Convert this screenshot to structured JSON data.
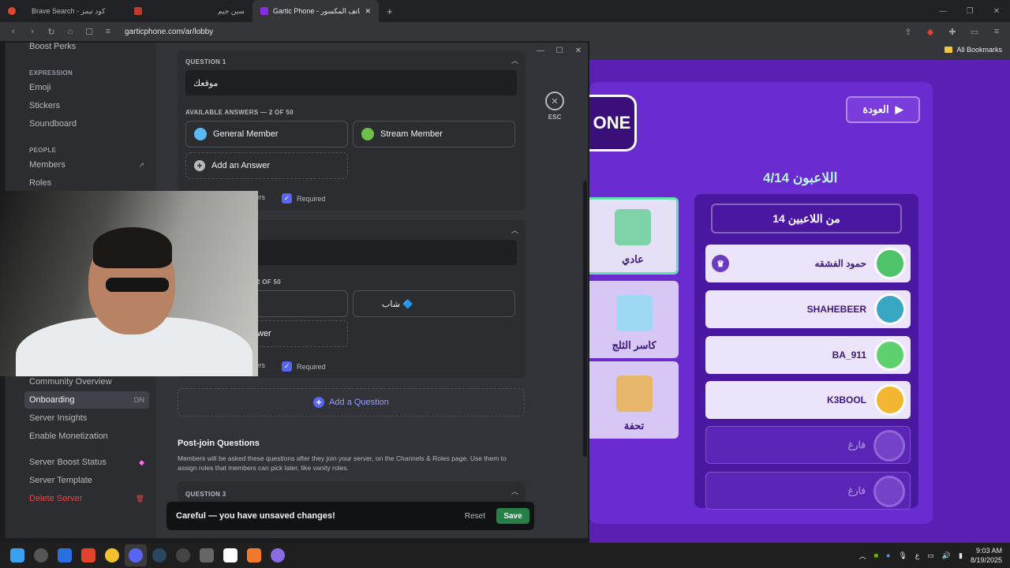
{
  "browser": {
    "tabs": [
      {
        "label": "Brave Search - كود تيمز",
        "color": "#e0442a",
        "active": false
      },
      {
        "label": "سين جيم",
        "color": "#c0392b",
        "active": false
      },
      {
        "label": "Gartic Phone - لعبة الهاتف المكسور",
        "color": "#8a2be2",
        "active": true
      }
    ],
    "new_tab": "+",
    "url": "garticphone.com/ar/lobby",
    "bookmarks_label": "All Bookmarks"
  },
  "game": {
    "back_label": "العودة",
    "logo_text": "ONE",
    "players_title": "اللاعبون 4/14",
    "players_header": "14 من اللاعبين",
    "players": [
      {
        "name": "حمود الفشقه",
        "empty": false,
        "crown": true,
        "color": "#4ec36a"
      },
      {
        "name": "SHAHEBEER",
        "empty": false,
        "crown": false,
        "color": "#3aa7c2"
      },
      {
        "name": "BA_911",
        "empty": false,
        "crown": false,
        "color": "#5ed06e"
      },
      {
        "name": "K3BOOL",
        "empty": false,
        "crown": false,
        "color": "#f2b632"
      },
      {
        "name": "فارغ",
        "empty": true,
        "crown": false,
        "color": "#7442c8"
      },
      {
        "name": "فارغ",
        "empty": true,
        "crown": false,
        "color": "#7442c8"
      }
    ],
    "modes": [
      {
        "label": "عادي",
        "selected": true,
        "color": "#7fd3a8"
      },
      {
        "label": "كاسر الثلج",
        "selected": false,
        "color": "#9fd8f5"
      },
      {
        "label": "تحفة",
        "selected": false,
        "color": "#e6b66a"
      }
    ]
  },
  "discord": {
    "sidebar": {
      "top_item": "Boost Perks",
      "expression_header": "EXPRESSION",
      "expression_items": [
        "Emoji",
        "Stickers",
        "Soundboard"
      ],
      "people_header": "PEOPLE",
      "people_items": [
        "Members",
        "Roles"
      ],
      "community_items": [
        {
          "label": "Community Overview",
          "right": ""
        },
        {
          "label": "Onboarding",
          "right": "ON"
        },
        {
          "label": "Server Insights",
          "right": ""
        },
        {
          "label": "Enable Monetization",
          "right": ""
        }
      ],
      "boost_status": "Server Boost Status",
      "server_template": "Server Template",
      "delete_server": "Delete Server"
    },
    "question1": {
      "label": "QUESTION 1",
      "value": "موقعك",
      "answers_label": "AVAILABLE ANSWERS — 2 OF 50",
      "answers": [
        {
          "label": "General Member",
          "color": "#5ab8f5"
        },
        {
          "label": "Stream Member",
          "color": "#6cc04a"
        }
      ],
      "add_answer": "Add an Answer",
      "multi_label": "Allow Multiple Answers",
      "multi_visible": "wers",
      "required": "Required"
    },
    "question2": {
      "answers_label_visible": "2 OF 50",
      "answer_right": "شاب 🔷",
      "add_answer_visible": "wer",
      "multi_visible": "wers",
      "required": "Required"
    },
    "add_question": "Add a Question",
    "post_join_title": "Post-join Questions",
    "post_join_desc": "Members will be asked these questions after they join your server, on the Channels & Roles page. Use them to assign roles that members can pick later, like vanity roles.",
    "question3_label": "QUESTION 3",
    "esc_label": "ESC",
    "unsaved_text": "Careful — you have unsaved changes!",
    "reset_label": "Reset",
    "save_label": "Save"
  },
  "taskbar": {
    "icons": [
      {
        "name": "windows-start-icon",
        "color": "#3aa0f0"
      },
      {
        "name": "app-circle-icon",
        "color": "#555555"
      },
      {
        "name": "w-app-icon",
        "color": "#2a6fe0"
      },
      {
        "name": "brave-icon",
        "color": "#e0442a"
      },
      {
        "name": "chrome-icon",
        "color": "#f2c12e"
      },
      {
        "name": "discord-icon",
        "color": "#5865f2"
      },
      {
        "name": "steam-icon",
        "color": "#2a475e"
      },
      {
        "name": "app-ea-icon",
        "color": "#444444"
      },
      {
        "name": "app-settings-icon",
        "color": "#666666"
      },
      {
        "name": "capcut-icon",
        "color": "#ffffff"
      },
      {
        "name": "app-triangle-icon",
        "color": "#f07a2a"
      },
      {
        "name": "app-chat-icon",
        "color": "#8a6be2"
      }
    ],
    "lang": "ع",
    "time": "9:03 AM",
    "date": "8/19/2025"
  }
}
